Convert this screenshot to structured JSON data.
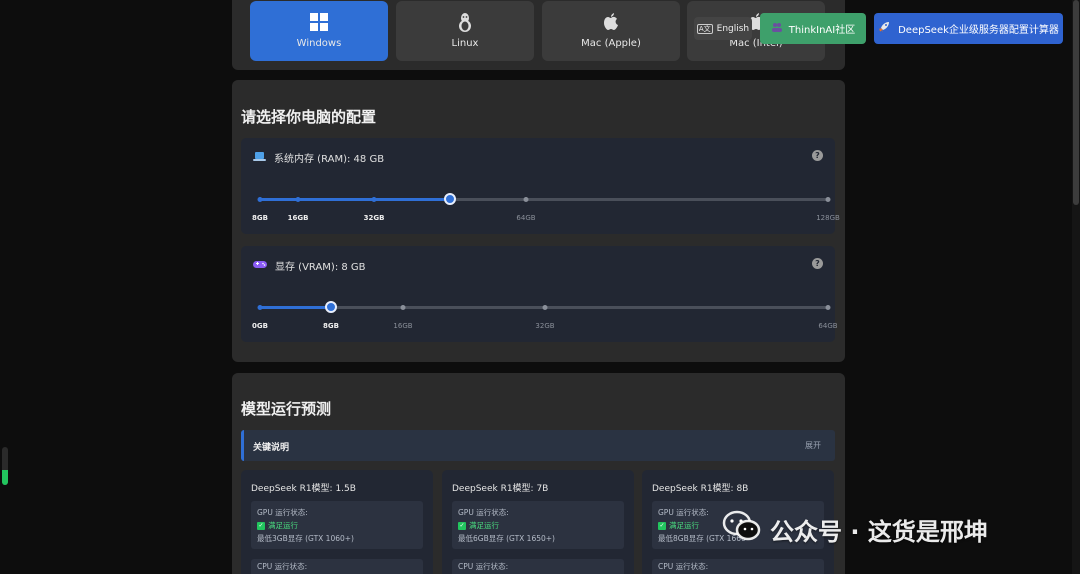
{
  "os_tabs": [
    {
      "label": "Windows",
      "icon": "windows-icon",
      "active": true
    },
    {
      "label": "Linux",
      "icon": "linux-icon",
      "active": false
    },
    {
      "label": "Mac (Apple)",
      "icon": "apple-icon",
      "active": false
    },
    {
      "label": "Mac (Intel)",
      "icon": "apple-icon",
      "active": false
    }
  ],
  "header": {
    "lang_label": "English",
    "lang_icon": "keyboard-icon",
    "community_label": "ThinkInAI社区",
    "community_icon": "users-icon",
    "calc_label": "DeepSeek企业级服务器配置计算器",
    "calc_icon": "rocket-icon"
  },
  "config": {
    "title": "请选择你电脑的配置",
    "ram": {
      "label": "系统内存 (RAM): 48 GB",
      "icon": "laptop-icon",
      "value_gb": 48,
      "ticks": [
        "8GB",
        "16GB",
        "32GB",
        "64GB",
        "128GB"
      ]
    },
    "vram": {
      "label": "显存 (VRAM): 8 GB",
      "icon": "gamepad-icon",
      "value_gb": 8,
      "ticks": [
        "0GB",
        "8GB",
        "16GB",
        "32GB",
        "64GB"
      ]
    },
    "help_icon": "question-icon"
  },
  "prediction": {
    "title": "模型运行预测",
    "key_title": "关键说明",
    "key_toggle": "展开",
    "models": [
      {
        "name": "DeepSeek R1模型: 1.5B",
        "gpu_label": "GPU 运行状态:",
        "gpu_status": "满足运行",
        "gpu_req": "最低3GB显存 (GTX 1060+)",
        "cpu_label": "CPU 运行状态:"
      },
      {
        "name": "DeepSeek R1模型: 7B",
        "gpu_label": "GPU 运行状态:",
        "gpu_status": "满足运行",
        "gpu_req": "最低6GB显存 (GTX 1650+)",
        "cpu_label": "CPU 运行状态:"
      },
      {
        "name": "DeepSeek R1模型: 8B",
        "gpu_label": "GPU 运行状态:",
        "gpu_status": "满足运行",
        "gpu_req": "最低8GB显存 (GTX 1660",
        "cpu_label": "CPU 运行状态:"
      }
    ]
  },
  "watermark": {
    "text": "公众号 · 这货是邢坤",
    "icon": "wechat-icon"
  },
  "colors": {
    "accent": "#2f6fd6",
    "success": "#22c55e",
    "community": "#3ea06b"
  }
}
